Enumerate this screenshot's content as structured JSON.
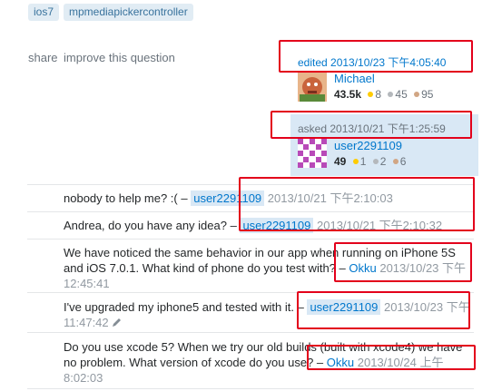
{
  "tags": [
    "ios7",
    "mpmediapickercontroller"
  ],
  "post_menu": {
    "share": "share",
    "improve": "improve this question"
  },
  "edited": {
    "label": "edited 2013/10/23 下午4:05:40",
    "user": "Michael",
    "reputation": "43.5k",
    "gold": "8",
    "silver": "45",
    "bronze": "95"
  },
  "asked": {
    "label": "asked 2013/10/21 下午1:25:59",
    "user": "user2291109",
    "reputation": "49",
    "gold": "1",
    "silver": "2",
    "bronze": "6"
  },
  "comments": [
    {
      "text": "nobody to help me? :( –",
      "user": "user2291109",
      "date": "2013/10/21 下午2:10:03"
    },
    {
      "text": "Andrea, do you have any idea? –",
      "user": "user2291109",
      "date": "2013/10/21 下午2:10:32"
    },
    {
      "text": "We have noticed the same behavior in our app when running on iPhone 5S and iOS 7.0.1. What kind of phone do you test with? –",
      "user": "Okku",
      "date": "2013/10/23 下午 12:45:41"
    },
    {
      "text": "I've upgraded my iphone5 and tested with it. –",
      "user": "user2291109",
      "date": "2013/10/23 下午11:47:42"
    },
    {
      "text": "Do you use xcode 5? When we try our old builds (built with xcode4) we have no problem. What version of xcode do you use? –",
      "user": "Okku",
      "date": "2013/10/24 上午 8:02:03"
    }
  ],
  "colors": {
    "link": "#0077cc",
    "highlight_box": "#e3001b",
    "owner_card": "#d9e8f5"
  }
}
